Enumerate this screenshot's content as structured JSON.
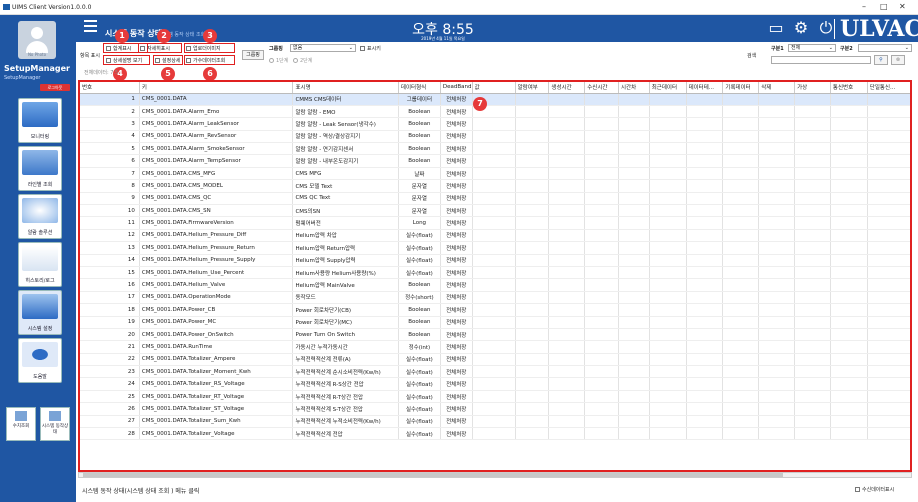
{
  "window": {
    "title": "UIMS Client Version1.0.0.0",
    "min": "–",
    "max": "□",
    "close": "✕"
  },
  "sidebar": {
    "avatar_status": "No Photo",
    "user_name": "SetupManager",
    "user_role": "SetupManager",
    "logout": "로그아웃",
    "items": [
      {
        "label": "모니터링"
      },
      {
        "label": "라인별 조회"
      },
      {
        "label": "알람 솔루션"
      },
      {
        "label": "히스토리/로그"
      },
      {
        "label": "시스템 설정"
      },
      {
        "label": "도움말"
      }
    ],
    "small_items": [
      {
        "label": "수치조회"
      },
      {
        "label": "시스템 동작상태"
      }
    ]
  },
  "header": {
    "title": "시스템 동작 상태",
    "subtitle": "시스템 동작 상태 조회",
    "clock": "오후 8:55",
    "date": "2019년 4월 11일 목요일",
    "logo": "ULVAC"
  },
  "filter": {
    "display_label": "항목 표시",
    "checkboxes": [
      {
        "label": "합계표시",
        "n": "1"
      },
      {
        "label": "자세히표시",
        "n": "2"
      },
      {
        "label": "업로더이미지",
        "n": "3"
      },
      {
        "label": "상세설명 보기",
        "n": "4"
      },
      {
        "label": "설정상세",
        "n": "5"
      },
      {
        "label": "가수데이터조회",
        "n": "6"
      }
    ],
    "group_button": "그룹핑",
    "group_label": "그룹핑",
    "group_value": "없음",
    "show_key": "표시키",
    "radio1": "1단계",
    "radio2": "2단계",
    "search_label": "검색",
    "group1_label": "구분1",
    "group1_value": "전체",
    "group2_label": "구분2",
    "group2_value": "",
    "search_value": "",
    "total_text": "전체데이터: 7.5"
  },
  "table": {
    "badge": "7",
    "columns": [
      "번호",
      "키",
      "표시명",
      "데이터형식",
      "DeadBand",
      "값",
      "알람여부",
      "생성시간",
      "수신시간",
      "시간차",
      "최근데이터",
      "데이터테...",
      "기록데이터",
      "삭제",
      "가상",
      "통신번호",
      "단일통신..."
    ],
    "rows": [
      [
        "1",
        "CMS_0001.DATA",
        "CMMS CMS데이터",
        "그룹데이터",
        "전체처장"
      ],
      [
        "2",
        "CMS_0001.DATA.Alarm_Emo",
        "알람 알람 - EMO",
        "Boolean",
        "전체처장"
      ],
      [
        "3",
        "CMS_0001.DATA.Alarm_LeakSensor",
        "알람 알람 - Leak Sensor(냉각수)",
        "Boolean",
        "전체처장"
      ],
      [
        "4",
        "CMS_0001.DATA.Alarm_RevSensor",
        "알람 알람 - 역상/결상감지기",
        "Boolean",
        "전체처장"
      ],
      [
        "5",
        "CMS_0001.DATA.Alarm_SmokeSensor",
        "알람 알람 - 연기감지센서",
        "Boolean",
        "전체처장"
      ],
      [
        "6",
        "CMS_0001.DATA.Alarm_TempSensor",
        "알람 알람 - 내부온도감지기",
        "Boolean",
        "전체처장"
      ],
      [
        "7",
        "CMS_0001.DATA.CMS_MFG",
        "CMS MFG",
        "날짜",
        "전체처장"
      ],
      [
        "8",
        "CMS_0001.DATA.CMS_MODEL",
        "CMS 모델 Text",
        "문자열",
        "전체처장"
      ],
      [
        "9",
        "CMS_0001.DATA.CMS_QC",
        "CMS QC Text",
        "문자열",
        "전체처장"
      ],
      [
        "10",
        "CMS_0001.DATA.CMS_SN",
        "CMS의SN",
        "문자열",
        "전체처장"
      ],
      [
        "11",
        "CMS_0001.DATA.FirmwareVersion",
        "펌웨어버전",
        "Long",
        "전체처장"
      ],
      [
        "12",
        "CMS_0001.DATA.Helium_Pressure_Diff",
        "Helium압력 차압",
        "실수(float)",
        "전체처장"
      ],
      [
        "13",
        "CMS_0001.DATA.Helium_Pressure_Return",
        "Helium압력 Return압력",
        "실수(float)",
        "전체처장"
      ],
      [
        "14",
        "CMS_0001.DATA.Helium_Pressure_Supply",
        "Helium압력 Supply압력",
        "실수(float)",
        "전체처장"
      ],
      [
        "15",
        "CMS_0001.DATA.Helium_Use_Percent",
        "Helium사용량 Helium사용량(%)",
        "실수(float)",
        "전체처장"
      ],
      [
        "16",
        "CMS_0001.DATA.Helium_Valve",
        "Helium압력 MainValve",
        "Boolean",
        "전체처장"
      ],
      [
        "17",
        "CMS_0001.DATA.OperationMode",
        "동작모드",
        "정수(short)",
        "전체처장"
      ],
      [
        "18",
        "CMS_0001.DATA.Power_CB",
        "Power 회로차단기(CB)",
        "Boolean",
        "전체처장"
      ],
      [
        "19",
        "CMS_0001.DATA.Power_MC",
        "Power 회로차단기(MC)",
        "Boolean",
        "전체처장"
      ],
      [
        "20",
        "CMS_0001.DATA.Power_OnSwitch",
        "Power Turn On Switch",
        "Boolean",
        "전체처장"
      ],
      [
        "21",
        "CMS_0001.DATA.RunTime",
        "가동시간 누적가동시간",
        "정수(int)",
        "전체처장"
      ],
      [
        "22",
        "CMS_0001.DATA.Totalizer_Ampere",
        "누적전력적산계 전류(A)",
        "실수(float)",
        "전체처장"
      ],
      [
        "23",
        "CMS_0001.DATA.Totalizer_Moment_Kwh",
        "누적전력적산계 순시소비전력(Kw/h)",
        "실수(float)",
        "전체처장"
      ],
      [
        "24",
        "CMS_0001.DATA.Totalizer_RS_Voltage",
        "누적전력적산계 R-S상간 전압",
        "실수(float)",
        "전체처장"
      ],
      [
        "25",
        "CMS_0001.DATA.Totalizer_RT_Voltage",
        "누적전력적산계 R-T상간 전압",
        "실수(float)",
        "전체처장"
      ],
      [
        "26",
        "CMS_0001.DATA.Totalizer_ST_Voltage",
        "누적전력적산계 S-T상간 전압",
        "실수(float)",
        "전체처장"
      ],
      [
        "27",
        "CMS_0001.DATA.Totalizer_Sum_Kwh",
        "누적전력적산계 누적소비전력(Kw/h)",
        "실수(float)",
        "전체처장"
      ],
      [
        "28",
        "CMS_0001.DATA.Totalizer_Voltage",
        "누적전력적산계 전압",
        "실수(float)",
        "전체처장"
      ]
    ]
  },
  "status": {
    "text": "시스템 동작 상태(시스템 상태 조회 ) 메뉴 클릭",
    "right": "수신데이터표시"
  }
}
